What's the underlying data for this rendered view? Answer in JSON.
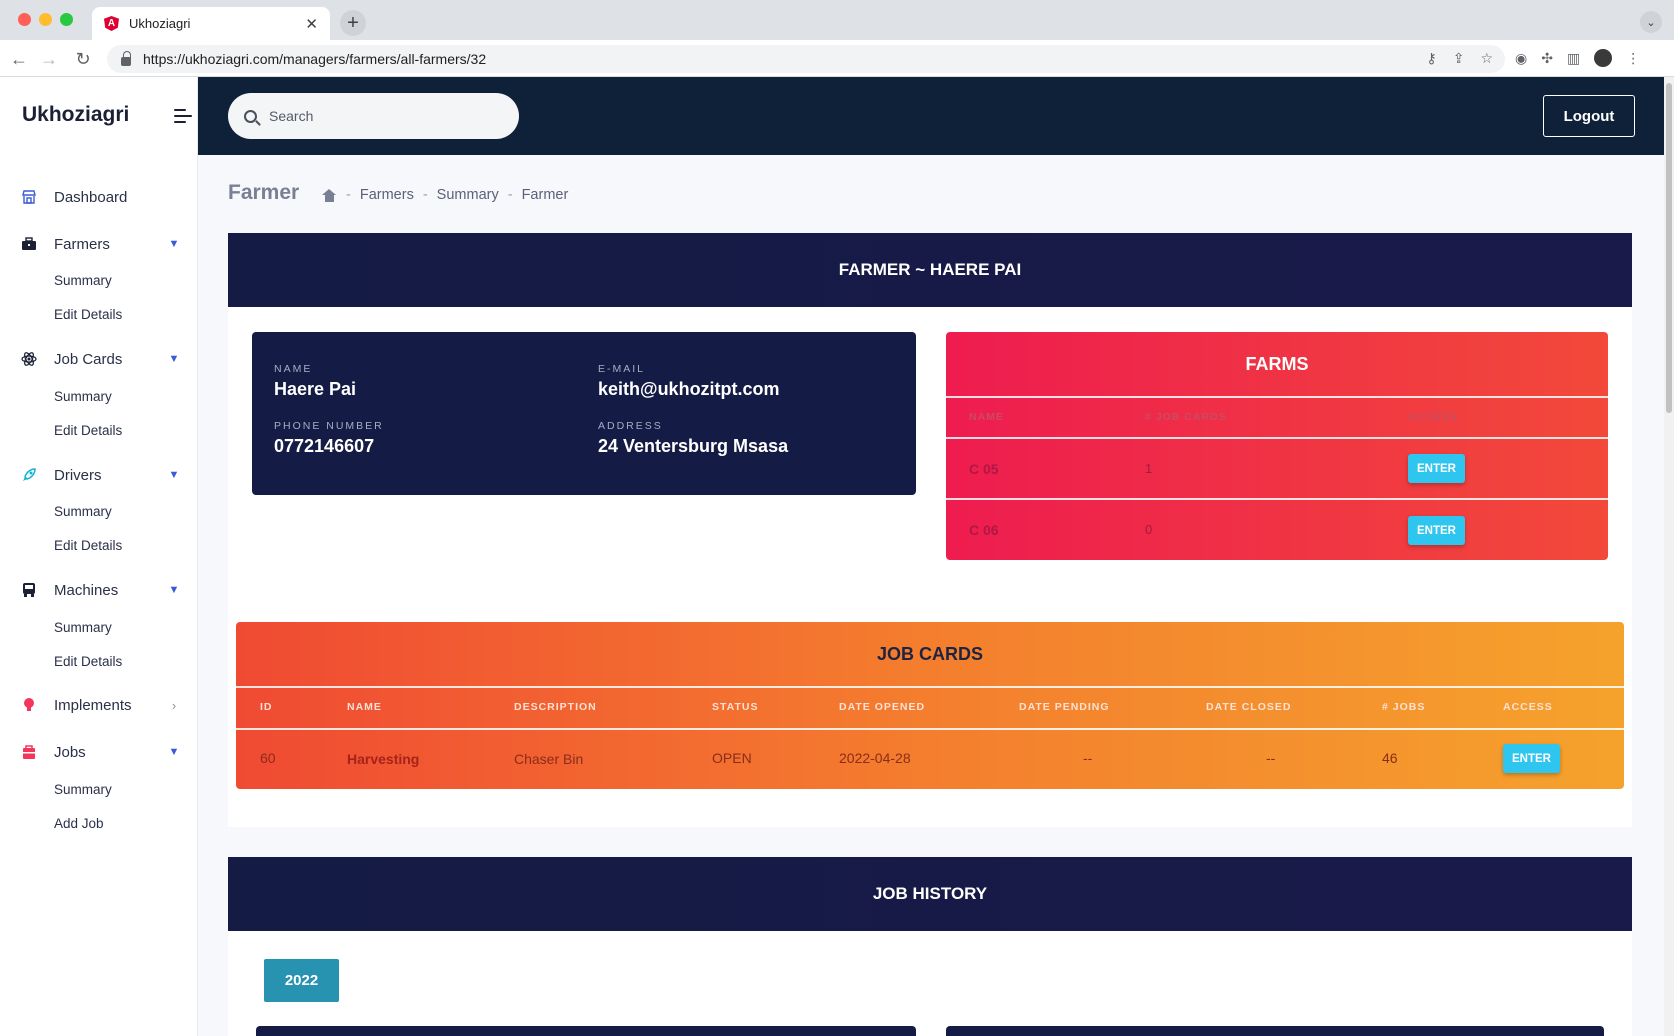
{
  "browser": {
    "tab_title": "Ukhoziagri",
    "tab_close": "✕",
    "new_tab": "+",
    "url": "https://ukhoziagri.com/managers/farmers/all-farmers/32"
  },
  "sidebar": {
    "brand": "Ukhoziagri",
    "items": [
      {
        "label": "Dashboard",
        "icon": "store-icon"
      },
      {
        "label": "Farmers",
        "icon": "briefcase-icon",
        "subs": [
          "Summary",
          "Edit Details"
        ]
      },
      {
        "label": "Job Cards",
        "icon": "atom-icon",
        "subs": [
          "Summary",
          "Edit Details"
        ]
      },
      {
        "label": "Drivers",
        "icon": "rocket-icon",
        "subs": [
          "Summary",
          "Edit Details"
        ]
      },
      {
        "label": "Machines",
        "icon": "bus-icon",
        "subs": [
          "Summary",
          "Edit Details"
        ]
      },
      {
        "label": "Implements",
        "icon": "bulb-icon"
      },
      {
        "label": "Jobs",
        "icon": "bag-icon",
        "subs": [
          "Summary",
          "Add Job"
        ]
      }
    ]
  },
  "header": {
    "search_placeholder": "Search",
    "logout_label": "Logout"
  },
  "page": {
    "title": "Farmer",
    "breadcrumb": [
      "Farmers",
      "Summary",
      "Farmer"
    ]
  },
  "farmer": {
    "header": "FARMER ~ HAERE PAI",
    "name_label": "NAME",
    "name": "Haere Pai",
    "email_label": "E-MAIL",
    "email": "keith@ukhozitpt.com",
    "phone_label": "PHONE NUMBER",
    "phone": "0772146607",
    "address_label": "ADDRESS",
    "address": "24 Ventersburg Msasa"
  },
  "farms": {
    "title": "FARMS",
    "columns": [
      "NAME",
      "# JOB CARDS",
      "ACCESS"
    ],
    "rows": [
      {
        "name": "C 05",
        "job_cards": "1",
        "action": "ENTER"
      },
      {
        "name": "C 06",
        "job_cards": "0",
        "action": "ENTER"
      }
    ]
  },
  "job_cards": {
    "title": "JOB CARDS",
    "columns": [
      "ID",
      "NAME",
      "DESCRIPTION",
      "STATUS",
      "DATE OPENED",
      "DATE PENDING",
      "DATE CLOSED",
      "# JOBS",
      "ACCESS"
    ],
    "rows": [
      {
        "id": "60",
        "name": "Harvesting",
        "description": "Chaser Bin",
        "status": "OPEN",
        "date_opened": "2022-04-28",
        "date_pending": "--",
        "date_closed": "--",
        "jobs": "46",
        "action": "ENTER"
      }
    ]
  },
  "job_history": {
    "title": "JOB HISTORY",
    "year": "2022"
  },
  "colors": {
    "navy": "#141b44",
    "topbar": "#0f2139",
    "farms_gradient": [
      "#ee1c4f",
      "#f2493a"
    ],
    "jobcards_gradient": [
      "#f04a33",
      "#f5a22d"
    ],
    "enter_button": "#2ec6ef",
    "year_button": "#2892b1"
  }
}
